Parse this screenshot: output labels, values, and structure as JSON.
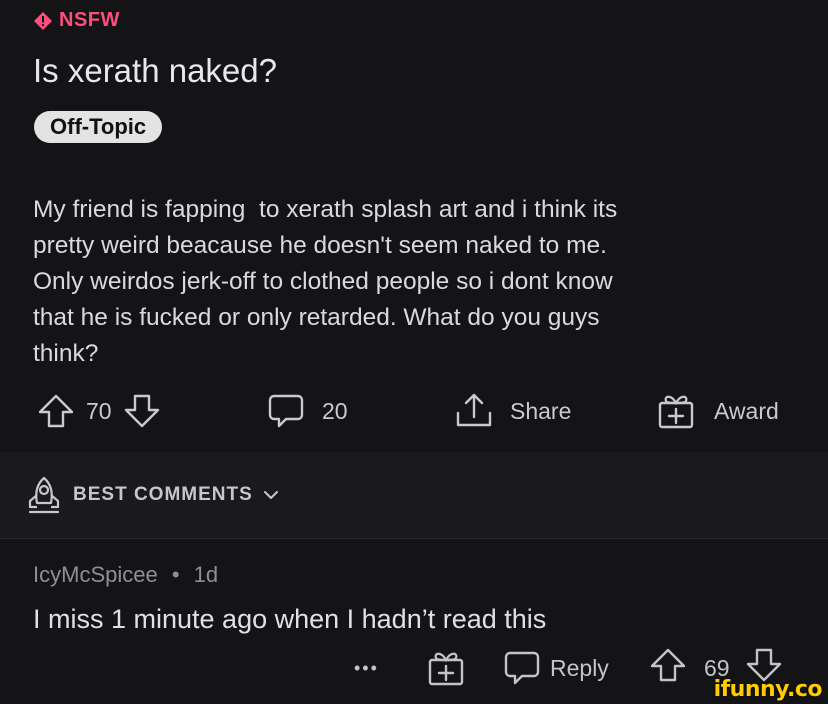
{
  "post": {
    "nsfw_label": "NSFW",
    "title": "Is xerath naked?",
    "flair": "Off-Topic",
    "body": "My friend is fapping  to xerath splash art and i think its\npretty weird beacause he doesn't seem naked to me.\nOnly weirdos jerk-off to clothed people so i dont know\nthat he is fucked or only retarded. What do you guys\nthink?",
    "votes": "70",
    "comments": "20",
    "share_label": "Share",
    "award_label": "Award"
  },
  "sort": {
    "label": "BEST COMMENTS"
  },
  "comment": {
    "author": "IcyMcSpicee",
    "separator": "•",
    "age": "1d",
    "text": "I miss 1 minute ago when I hadn’t read this",
    "more": "•••",
    "reply_label": "Reply",
    "votes": "69"
  },
  "watermark": "ifunny.co",
  "colors": {
    "background": "#141416",
    "nsfw": "#ff4d7d",
    "flair_bg": "#e3e3e3",
    "watermark": "#ffcc00"
  }
}
